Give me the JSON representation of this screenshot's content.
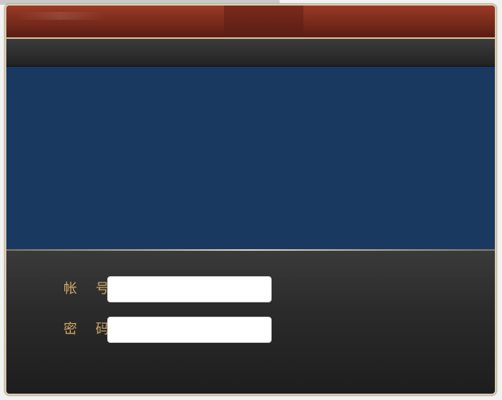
{
  "login_form": {
    "account": {
      "label": "帐 号",
      "value": "",
      "placeholder": ""
    },
    "password": {
      "label": "密 码",
      "value": "",
      "placeholder": ""
    }
  },
  "colors": {
    "titlebar": "#84301f",
    "toolbar": "#2e2e2e",
    "banner": "#1a3961",
    "form_background": "#2b2b2b",
    "label_gold": "#cfa867",
    "frame_border": "#d9ccb0"
  }
}
